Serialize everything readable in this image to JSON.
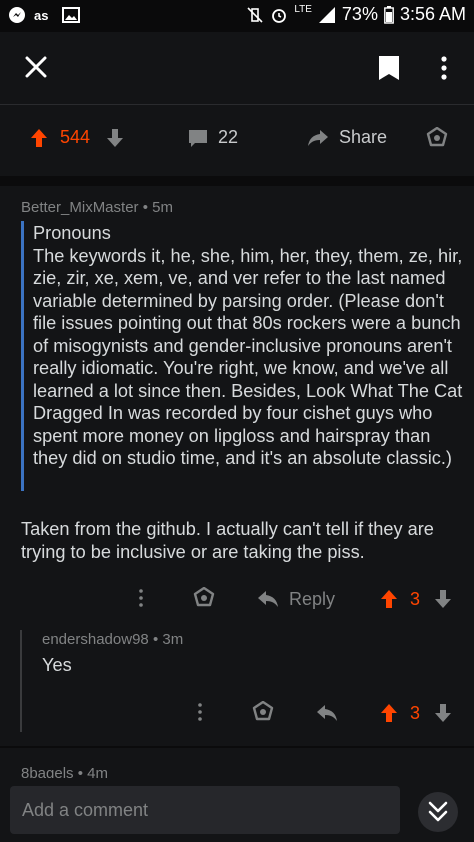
{
  "status_bar": {
    "battery_pct": "73%",
    "time": "3:56 AM",
    "network": "LTE",
    "left_icons": [
      "messenger-icon",
      "lastfm-icon",
      "gallery-icon"
    ],
    "right_icons": [
      "vibrate-mute-icon",
      "alarm-icon",
      "signal-icon",
      "battery-icon"
    ]
  },
  "post_actions": {
    "upvotes": "544",
    "comments": "22",
    "share_label": "Share"
  },
  "comments": [
    {
      "author": "Better_MixMaster",
      "age": "5m",
      "quote_title": "Pronouns",
      "quote_body": "The keywords it, he, she, him, her, they, them, ze, hir, zie, zir, xe, xem, ve, and ver refer to the last named variable determined by parsing order. (Please don't file issues pointing out that 80s rockers were a bunch of misogynists and gender-inclusive pronouns aren't really idiomatic. You're right, we know, and we've all learned a lot since then. Besides, Look What The Cat Dragged In was recorded by four cishet guys who spent more money on lipgloss and hairspray than they did on studio time, and it's an absolute classic.)",
      "body": "Taken from the github. I actually can't tell if they are trying to be inclusive or are taking the piss.",
      "reply_label": "Reply",
      "score": "3"
    },
    {
      "author": "endershadow98",
      "age": "3m",
      "body": "Yes",
      "score": "3"
    },
    {
      "author": "8bagels",
      "age": "4m"
    }
  ],
  "composer": {
    "placeholder": "Add a comment"
  },
  "colors": {
    "upvote": "#ff4500",
    "quote_bar": "#3b73c2",
    "background": "#131416"
  }
}
